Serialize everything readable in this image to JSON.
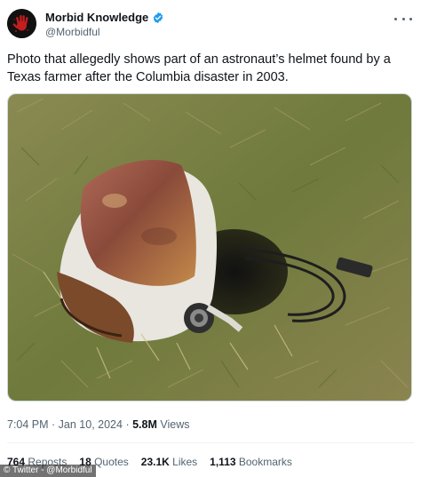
{
  "author": {
    "name": "Morbid Knowledge",
    "handle": "@Morbidful",
    "verified": true,
    "avatar_icon": "red-handprint-icon"
  },
  "tweet": {
    "text": "Photo that allegedly shows part of an astronaut’s helmet found by a Texas farmer after the Columbia disaster in 2003."
  },
  "meta": {
    "time": "7:04 PM",
    "separator": " · ",
    "date": "Jan 10, 2024",
    "views_count": "5.8M",
    "views_label": " Views"
  },
  "stats": {
    "reposts_count": "764",
    "reposts_label": " Reposts",
    "quotes_count": "18",
    "quotes_label": " Quotes",
    "likes_count": "23.1K",
    "likes_label": " Likes",
    "bookmarks_count": "1,113",
    "bookmarks_label": " Bookmarks"
  },
  "watermark": "© Twitter - @Morbidful",
  "colors": {
    "verified_badge": "#1d9bf0",
    "secondary_text": "#536471",
    "avatar_bg": "#111111",
    "avatar_hand": "#c41e1e"
  }
}
